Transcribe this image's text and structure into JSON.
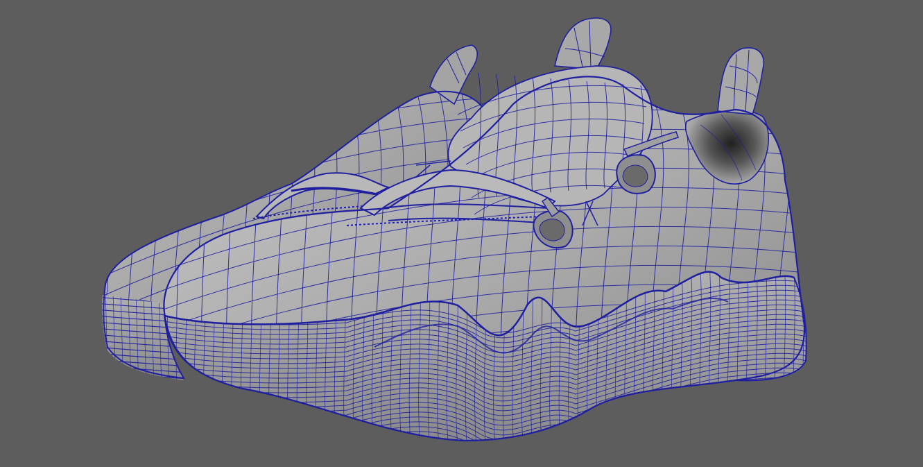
{
  "viewport": {
    "background_color": "#5d5d5d",
    "wire_color": "#1f1fa0",
    "surface_light": "#b4b4b4",
    "surface_mid": "#9a9a9a",
    "surface_dark": "#6e6e6e",
    "shading_mode": "wireframe-on-shaded"
  },
  "scene": {
    "object": "sneaker-pair",
    "object_icon": "shoe-mesh-icon"
  }
}
